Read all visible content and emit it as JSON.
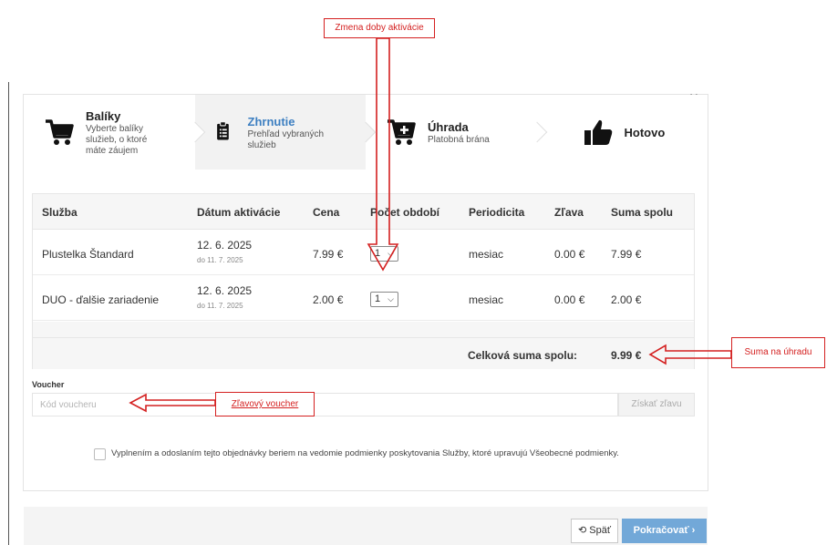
{
  "steps": [
    {
      "title": "Balíky",
      "desc1": "Vyberte balíky",
      "desc2": "služieb, o ktoré",
      "desc3": "máte záujem",
      "icon": "cart-icon"
    },
    {
      "title": "Zhrnutie",
      "desc1": "Prehľad vybraných",
      "desc2": "služieb",
      "icon": "clipboard-icon"
    },
    {
      "title": "Úhrada",
      "desc1": "Platobná brána",
      "icon": "cart-plus-icon"
    },
    {
      "title": "Hotovo",
      "icon": "thumbs-up-icon"
    }
  ],
  "close_label": "×",
  "table": {
    "headers": [
      "Služba",
      "Dátum aktivácie",
      "Cena",
      "Počet období",
      "Periodicita",
      "Zľava",
      "Suma spolu"
    ],
    "rows": [
      {
        "service": "Plustelka Štandard",
        "date": "12. 6. 2025",
        "until": "do 11. 7. 2025",
        "price": "7.99 €",
        "periods": "1",
        "periodicity": "mesiac",
        "discount": "0.00 €",
        "total": "7.99 €"
      },
      {
        "service": "DUO - ďalšie zariadenie",
        "date": "12. 6. 2025",
        "until": "do 11. 7. 2025",
        "price": "2.00 €",
        "periods": "1",
        "periodicity": "mesiac",
        "discount": "0.00 €",
        "total": "2.00 €"
      }
    ],
    "total_label": "Celková suma spolu:",
    "total_value": "9.99 €"
  },
  "voucher": {
    "label": "Voucher",
    "placeholder": "Kód voucheru",
    "button": "Získať zľavu"
  },
  "terms": "Vyplnením a odoslaním tejto objednávky beriem na vedomie podmienky poskytovania Služby, ktoré upravujú Všeobecné podmienky.",
  "footer": {
    "back": "⟲ Späť",
    "next": "Pokračovať ›"
  },
  "annotations": {
    "activation": "Zmena doby aktivácie",
    "sum": "Suma na úhradu",
    "voucher": "Zľavový voucher"
  },
  "colors": {
    "accent": "#3d7fc1",
    "primary_button": "#72a8d8",
    "annotation": "#d42020"
  }
}
